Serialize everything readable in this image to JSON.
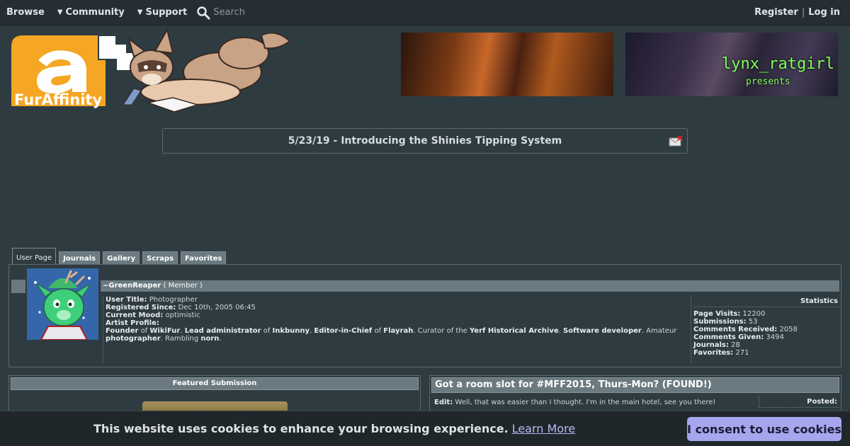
{
  "nav": {
    "browse": "Browse",
    "community": "Community",
    "support": "Support",
    "search_placeholder": "Search",
    "register": "Register",
    "separator": "|",
    "login": "Log in"
  },
  "logo": {
    "text": "FurAffinity"
  },
  "banner": {
    "line1": "lynx_ratgirl",
    "line2": "presents"
  },
  "notice": {
    "text": "5/23/19 - Introducing the Shinies Tipping System"
  },
  "tabs": [
    "User Page",
    "Journals",
    "Gallery",
    "Scraps",
    "Favorites"
  ],
  "user": {
    "name": "~GreenReaper",
    "role": "( Member )",
    "fields": {
      "title_label": "User Title:",
      "title_value": "Photographer",
      "since_label": "Registered Since:",
      "since_value": "Dec 10th, 2005 06:45",
      "mood_label": "Current Mood:",
      "mood_value": "optimistic",
      "profile_label": "Artist Profile:"
    },
    "profile": {
      "p1": "Founder",
      "p2": " of ",
      "p3": "WikiFur",
      "p4": ". ",
      "p5": "Lead administrator",
      "p6": " of ",
      "p7": "Inkbunny",
      "p8": ". ",
      "p9": "Editor-in-Chief",
      "p10": " of ",
      "p11": "Flayrah",
      "p12": ". Curator of the ",
      "p13": "Yerf Historical Archive",
      "p14": ". ",
      "p15": "Software developer",
      "p16": ". Amateur ",
      "p17": "photographer",
      "p18": ". Rambling ",
      "p19": "norn",
      "p20": "."
    }
  },
  "stats": {
    "heading": "Statistics",
    "page_visits_label": "Page Visits:",
    "page_visits": "12200",
    "submissions_label": "Submissions:",
    "submissions": "53",
    "comments_received_label": "Comments Received:",
    "comments_received": "2058",
    "comments_given_label": "Comments Given:",
    "comments_given": "3494",
    "journals_label": "Journals:",
    "journals": "28",
    "favorites_label": "Favorites:",
    "favorites": "271"
  },
  "featured": {
    "heading": "Featured Submission"
  },
  "journal": {
    "title": "Got a room slot for #MFF2015, Thurs-Mon? (FOUND!)",
    "edit_label": "Edit:",
    "edit_text": "Well, that was easier than I thought. I'm in the main hotel, see you there!",
    "posted_label": "Posted:"
  },
  "cookie": {
    "message": "This website uses cookies to enhance your browsing experience.",
    "learn_more": "Learn More",
    "consent": "I consent to use cookies"
  },
  "colors": {
    "accent": "#a6a6ee",
    "panel": "#6a7a80",
    "background": "#2e3b41",
    "logo_orange": "#f5a623"
  }
}
